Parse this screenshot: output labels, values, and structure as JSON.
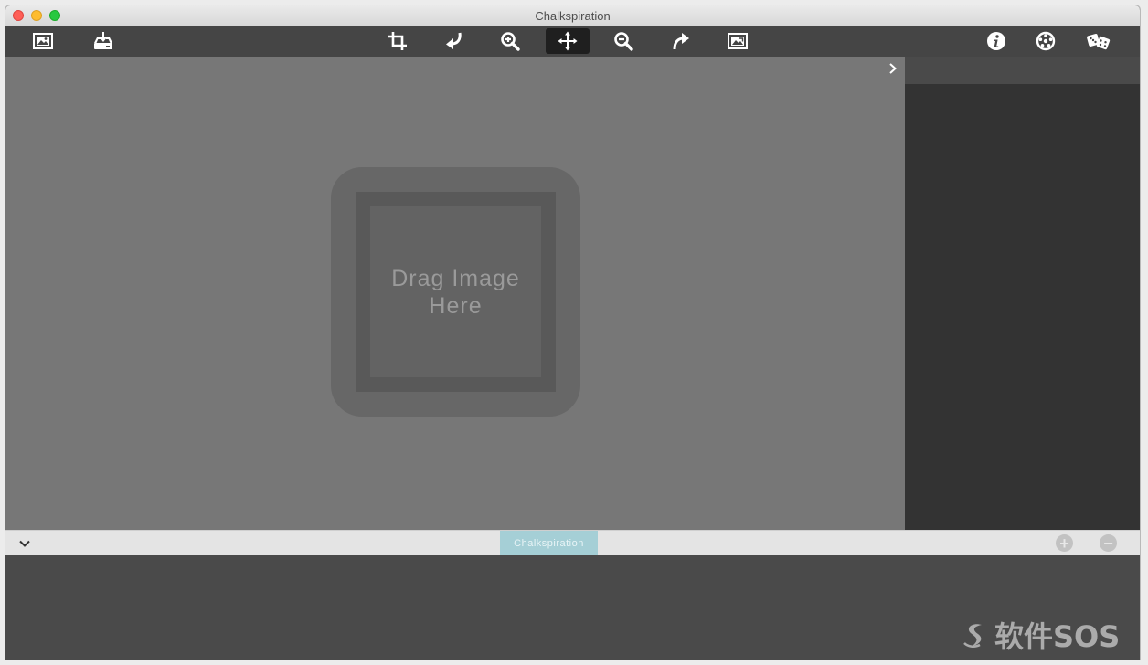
{
  "window": {
    "title": "Chalkspiration"
  },
  "toolbar": {
    "left": [
      {
        "name": "open-image-icon"
      },
      {
        "name": "save-image-icon"
      }
    ],
    "center": [
      {
        "name": "crop-icon"
      },
      {
        "name": "undo-icon"
      },
      {
        "name": "zoom-in-icon"
      },
      {
        "name": "move-icon",
        "active": true
      },
      {
        "name": "zoom-out-icon"
      },
      {
        "name": "redo-icon"
      },
      {
        "name": "export-image-icon"
      }
    ],
    "right": [
      {
        "name": "info-icon"
      },
      {
        "name": "settings-icon"
      },
      {
        "name": "dice-icon"
      }
    ]
  },
  "canvas": {
    "drop_line1": "Drag Image",
    "drop_line2": "Here"
  },
  "strip": {
    "tab_label": "Chalkspiration",
    "add": "+",
    "remove": "−"
  },
  "watermark": {
    "text": "软件SOS"
  },
  "colors": {
    "tab": "#a5cfd6",
    "canvas": "#777777",
    "panel": "#333333"
  }
}
